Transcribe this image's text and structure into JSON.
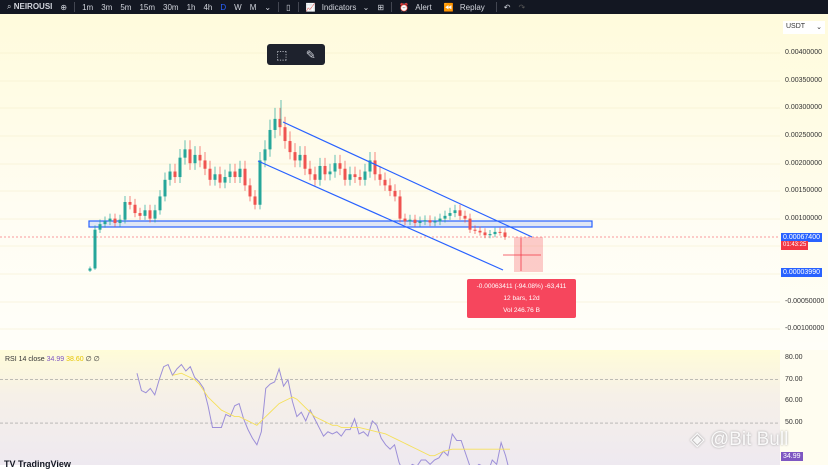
{
  "toolbar": {
    "symbol": "NEIROUSI",
    "intervals": [
      "1m",
      "3m",
      "5m",
      "15m",
      "30m",
      "1h",
      "4h",
      "D",
      "W",
      "M"
    ],
    "active_interval": "D",
    "indicators": "Indicators",
    "alert": "Alert",
    "replay": "Replay"
  },
  "price_axis": {
    "currency": "USDT",
    "ticks": [
      "0.00400000",
      "0.00350000",
      "0.00300000",
      "0.00250000",
      "0.00200000",
      "0.00150000",
      "0.00100000",
      "-0.00050000",
      "-0.00100000"
    ],
    "current_price": "0.00067400",
    "countdown": "01:43:25",
    "measure_price": "0.00003990"
  },
  "measure": {
    "line1": "-0.00063411 (-94.08%) -63,411",
    "line2": "12 bars, 12d",
    "line3": "Vol 246.76 B"
  },
  "rsi": {
    "title": "RSI 14 close",
    "value": "34.99",
    "ma_value": "38.60",
    "extra": "∅ ∅",
    "ticks": [
      "80.00",
      "70.00",
      "60.00",
      "50.00"
    ],
    "current_label": "34.99",
    "values": [
      73,
      65,
      64,
      66,
      63,
      70,
      76,
      77,
      72,
      75,
      77,
      74,
      76,
      71,
      69,
      66,
      58,
      48,
      48,
      48,
      54,
      53,
      58,
      59,
      52,
      47,
      43,
      40,
      46,
      66,
      68,
      69,
      75,
      67,
      70,
      60,
      53,
      55,
      51,
      56,
      52,
      48,
      44,
      46,
      45,
      46,
      44,
      47,
      47,
      52,
      45,
      46,
      44,
      51,
      49,
      43,
      40,
      38,
      40,
      32,
      27,
      29,
      31,
      30,
      33,
      33,
      31,
      33,
      34,
      37,
      35,
      45,
      42,
      42,
      36,
      30,
      29,
      31,
      30,
      27,
      33,
      31,
      41,
      35,
      27
    ],
    "ma": [
      null,
      null,
      null,
      null,
      null,
      null,
      null,
      null,
      72,
      72.5,
      73,
      72,
      71,
      70,
      68,
      65,
      62,
      60,
      58,
      56,
      55,
      54,
      53,
      53,
      52,
      51,
      50,
      49,
      51,
      53,
      55,
      57,
      59,
      60,
      61,
      62,
      61,
      59,
      57,
      55,
      53,
      52,
      51,
      50,
      49,
      49,
      48,
      48,
      48,
      48,
      48,
      47.5,
      47,
      46.5,
      46,
      45.5,
      45,
      44,
      43,
      42,
      41,
      40,
      39,
      38,
      37,
      36,
      35,
      35,
      36,
      37,
      37.5,
      38,
      38,
      38,
      38,
      38,
      38,
      38,
      38,
      38,
      38,
      38,
      38,
      38,
      38
    ]
  },
  "candles_close_e5": [
    10,
    80,
    90,
    95,
    100,
    92,
    98,
    130,
    125,
    110,
    105,
    115,
    100,
    115,
    140,
    170,
    185,
    175,
    210,
    225,
    200,
    215,
    205,
    190,
    170,
    180,
    165,
    175,
    185,
    175,
    190,
    160,
    140,
    125,
    205,
    225,
    260,
    280,
    265,
    240,
    220,
    205,
    215,
    190,
    180,
    170,
    195,
    180,
    185,
    200,
    190,
    170,
    180,
    175,
    170,
    185,
    205,
    180,
    170,
    160,
    150,
    140,
    100,
    95,
    98,
    92,
    95,
    97,
    93,
    95,
    100,
    105,
    110,
    115,
    105,
    100,
    80,
    78,
    75,
    70,
    72,
    76,
    75,
    67
  ],
  "watermark": "@Bit Bull",
  "brand": "TradingView",
  "colors": {
    "up": "#26a69a",
    "down": "#ef5350",
    "channel": "#2962ff",
    "rsi": "#9c8fd8",
    "rsi_ma": "#f5e05a"
  }
}
